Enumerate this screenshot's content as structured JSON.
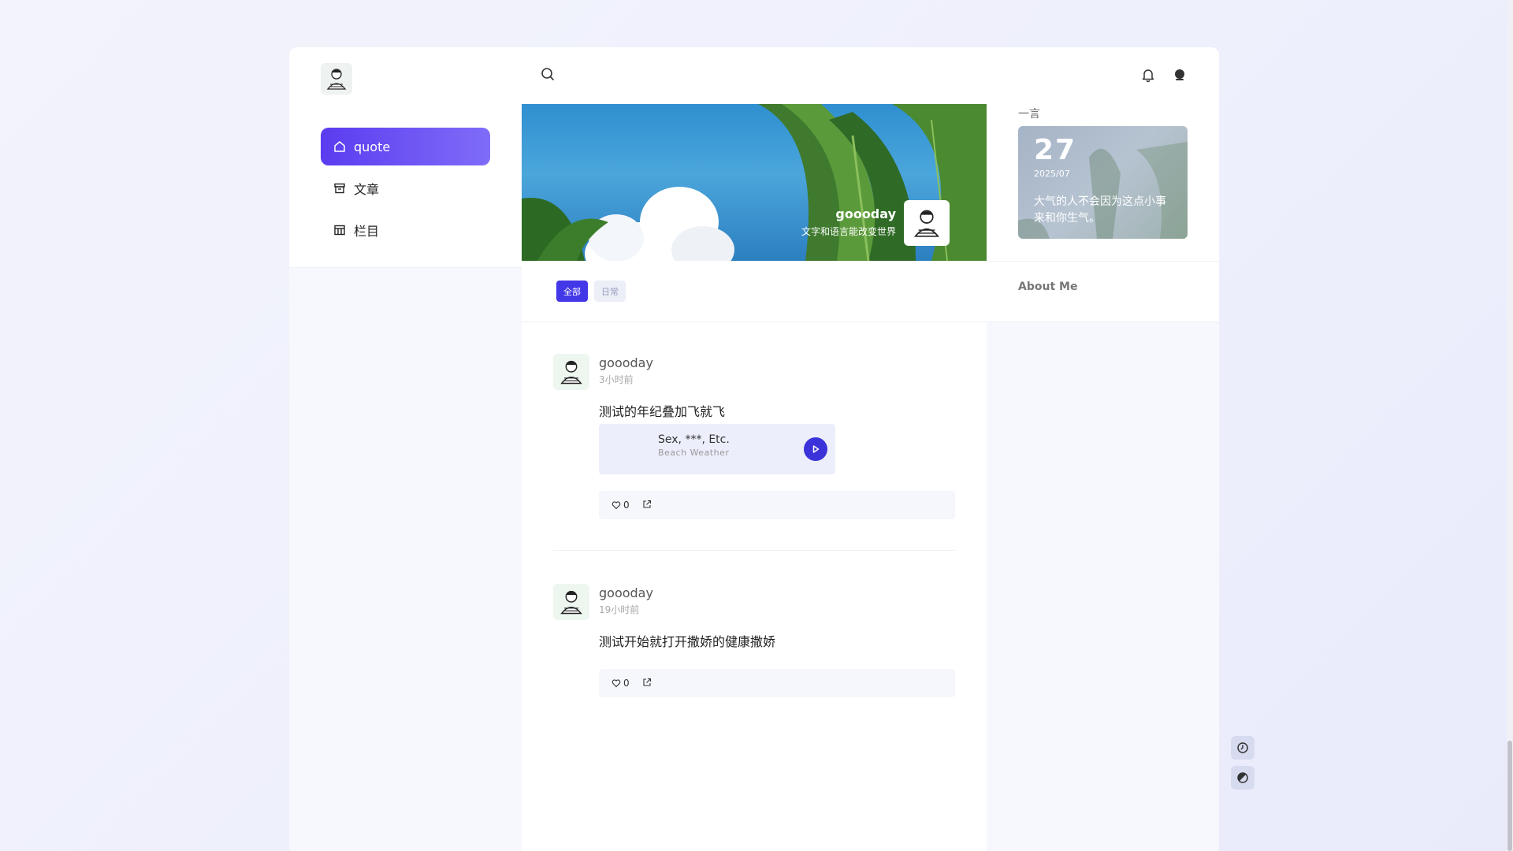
{
  "nav": {
    "items": [
      {
        "label": "quote",
        "icon": "home-icon",
        "active": true
      },
      {
        "label": "文章",
        "icon": "archive-icon",
        "active": false
      },
      {
        "label": "栏目",
        "icon": "table-icon",
        "active": false
      }
    ]
  },
  "banner": {
    "username": "goooday",
    "signature": "文字和语言能改变世界"
  },
  "filters": [
    {
      "label": "全部",
      "active": true
    },
    {
      "label": "日常",
      "active": false
    }
  ],
  "posts": [
    {
      "author": "goooday",
      "time": "3小时前",
      "text": "测试的年纪叠加飞就飞",
      "music": {
        "title": "Sex, ***, Etc.",
        "artist": "Beach Weather"
      },
      "likes": "0"
    },
    {
      "author": "goooday",
      "time": "19小时前",
      "text": "测试开始就打开撒娇的健康撒娇",
      "likes": "0"
    }
  ],
  "sidebar": {
    "quote_title": "一言",
    "quote_day": "27",
    "quote_ym": "2025/07",
    "quote_text": "大气的人不会因为这点小事来和你生气。",
    "about_title": "About Me"
  },
  "colors": {
    "accent": "#4338e8",
    "nav_active_start": "#5b3cf0",
    "nav_active_end": "#7f6cf8"
  }
}
